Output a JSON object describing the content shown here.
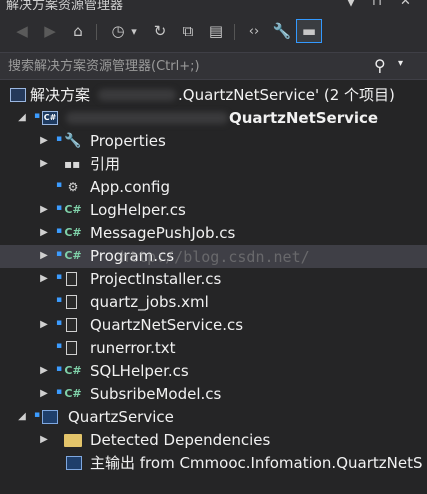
{
  "window": {
    "title": "解决方案资源管理器",
    "pin": "▼",
    "close": "✕"
  },
  "toolbar": {
    "buttons": [
      {
        "name": "back-icon",
        "glyph": "◀",
        "dim": true
      },
      {
        "name": "forward-icon",
        "glyph": "▶",
        "dim": true
      },
      {
        "name": "home-icon",
        "glyph": "⌂",
        "dim": false
      },
      {
        "name": "history-icon",
        "glyph": "◷",
        "dim": false
      },
      {
        "name": "history-dropdown-icon",
        "glyph": "▾",
        "dim": false
      },
      {
        "name": "sync-icon",
        "glyph": "↻",
        "dim": false
      },
      {
        "name": "collapse-all-icon",
        "glyph": "⧉",
        "dim": false
      },
      {
        "name": "show-all-files-icon",
        "glyph": "▤",
        "dim": false
      },
      {
        "name": "view-code-icon",
        "glyph": "‹›",
        "dim": false
      },
      {
        "name": "properties-icon",
        "glyph": "🔧",
        "dim": false
      },
      {
        "name": "preview-icon",
        "glyph": "▬",
        "dim": false
      }
    ]
  },
  "search": {
    "placeholder": "搜索解决方案资源管理器(Ctrl+;)",
    "icon": "⚲",
    "dropdown": "▾"
  },
  "tree": {
    "solution_prefix": "解决方案",
    "solution_suffix": ".QuartzNetService' (2 个项目)",
    "project_name": "QuartzNetService",
    "items": [
      {
        "label": "Properties",
        "kind": "properties"
      },
      {
        "label": "引用",
        "kind": "references"
      },
      {
        "label": "App.config",
        "kind": "config"
      },
      {
        "label": "LogHelper.cs",
        "kind": "cs"
      },
      {
        "label": "MessagePushJob.cs",
        "kind": "cs"
      },
      {
        "label": "Program.cs",
        "kind": "cs"
      },
      {
        "label": "ProjectInstaller.cs",
        "kind": "file"
      },
      {
        "label": "quartz_jobs.xml",
        "kind": "file"
      },
      {
        "label": "QuartzNetService.cs",
        "kind": "file"
      },
      {
        "label": "runerror.txt",
        "kind": "file"
      },
      {
        "label": "SQLHelper.cs",
        "kind": "cs"
      },
      {
        "label": "SubsribeModel.cs",
        "kind": "cs"
      }
    ],
    "second_project": "QuartzService",
    "second_items": [
      {
        "label": "Detected Dependencies"
      },
      {
        "label": "主输出 from Cmmooc.Infomation.QuartzNetS"
      }
    ]
  },
  "watermark": "http://blog.csdn.net/",
  "colors": {
    "background": "#252526",
    "selection": "#3f3f46",
    "accent": "#3399ff"
  }
}
